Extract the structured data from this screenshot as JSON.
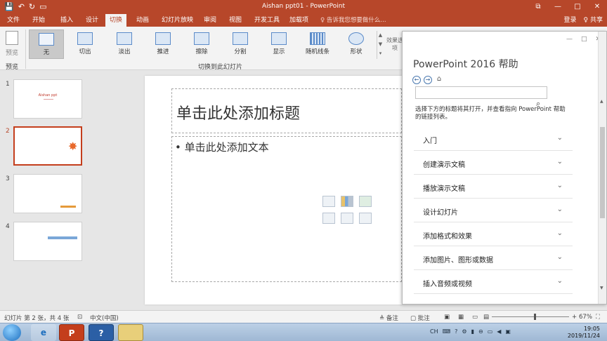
{
  "titlebar": {
    "title": "Aishan ppt01 - PowerPoint",
    "qat": {
      "save_icon": "save-icon",
      "undo": "↶",
      "redo": "↻",
      "present": "▭"
    },
    "controls": {
      "restore": "⧉",
      "minimize": "—",
      "maximize": "□",
      "close": "✕"
    }
  },
  "tabs": {
    "items": [
      "文件",
      "开始",
      "插入",
      "设计",
      "切换",
      "动画",
      "幻灯片放映",
      "审阅",
      "视图",
      "开发工具",
      "加载项"
    ],
    "active": "切换",
    "tell_me": "♀ 告诉我您想要做什么...",
    "signin": "登录",
    "share": "♀ 共享"
  },
  "ribbon": {
    "preview_label": "预览",
    "preview_group": "预览",
    "transitions": [
      "无",
      "切出",
      "淡出",
      "推进",
      "擦除",
      "分割",
      "显示",
      "随机线条",
      "形状"
    ],
    "selected": "无",
    "group_label": "切换到此幻灯片",
    "effect_options": "效果选项"
  },
  "slides": {
    "thumbs": [
      {
        "num": "1",
        "title": "Aishan ppt"
      },
      {
        "num": "2"
      },
      {
        "num": "3"
      },
      {
        "num": "4"
      }
    ],
    "active": "2"
  },
  "editor": {
    "title_placeholder": "单击此处添加标题",
    "body_placeholder": "• 单击此处添加文本"
  },
  "help": {
    "title": "PowerPoint 2016 帮助",
    "intro": "选择下方的标题将其打开，并查看指向 PowerPoint 帮助的链接列表。",
    "items": [
      "入门",
      "创建演示文稿",
      "播放演示文稿",
      "设计幻灯片",
      "添加格式和效果",
      "添加图片、图形或数据",
      "插入音频或视频"
    ]
  },
  "status": {
    "slide_info": "幻灯片 第 2 张，共 4 张",
    "language": "中文(中国)",
    "notes": "≜ 备注",
    "comments": "▢ 批注",
    "zoom": "67%",
    "zoom_minus": "−",
    "zoom_plus": "+"
  },
  "taskbar": {
    "ppt_label": "P",
    "help_label": "?",
    "time": "19:05",
    "date": "2019/11/24",
    "lang": "CH"
  }
}
